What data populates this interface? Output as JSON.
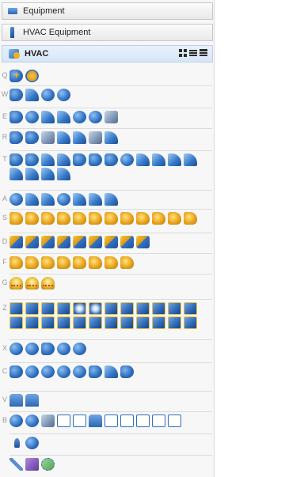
{
  "headers": {
    "equipment": "Equipment",
    "hvac_equipment": "HVAC Equipment",
    "hvac": "HVAC"
  },
  "view_tools": [
    "large-icons-view",
    "list-view",
    "details-view"
  ],
  "rows": [
    {
      "key": "Q",
      "icons": [
        "duct-plus",
        "gear"
      ]
    },
    {
      "key": "W",
      "icons": [
        "duct",
        "elbow",
        "round",
        "flex"
      ]
    },
    {
      "key": "E",
      "icons": [
        "duct",
        "round",
        "elbow",
        "elbow",
        "round",
        "round",
        "grey"
      ]
    },
    {
      "key": "R",
      "icons": [
        "duct",
        "duct",
        "grey",
        "elbow",
        "elbow",
        "grey",
        "elbow"
      ]
    },
    {
      "key": "T",
      "icons": [
        "duct",
        "duct",
        "elbow",
        "elbow",
        "duct",
        "duct",
        "duct",
        "round",
        "elbow",
        "elbow",
        "elbow",
        "elbow",
        "elbow",
        "elbow",
        "elbow",
        "elbow"
      ]
    },
    {
      "key": "A",
      "icons": [
        "round",
        "elbow",
        "elbow",
        "round",
        "elbow",
        "elbow",
        "elbow"
      ]
    },
    {
      "key": "S",
      "icons": [
        "yel",
        "yel",
        "yel",
        "yel",
        "yel",
        "yel",
        "yel",
        "yel",
        "yel",
        "yel",
        "yel",
        "yel"
      ]
    },
    {
      "key": "D",
      "icons": [
        "yelb",
        "yelb",
        "yelb",
        "yelb",
        "yelb",
        "yelb",
        "yelb",
        "yelb",
        "yelb"
      ]
    },
    {
      "key": "F",
      "icons": [
        "yel",
        "yel",
        "yel",
        "yel",
        "yel",
        "yel",
        "yel",
        "yel"
      ]
    },
    {
      "key": "G",
      "icons": [
        "fan",
        "fan",
        "fan"
      ]
    },
    {
      "key": "Z",
      "icons": [
        "sqr",
        "sqr",
        "sqr",
        "sqr",
        "sqrw",
        "sqrw",
        "sqr",
        "sqr",
        "sqr",
        "sqr",
        "sqr",
        "sqr",
        "sqr",
        "sqr",
        "sqr",
        "sqr",
        "sqr",
        "sqr",
        "sqr",
        "sqr",
        "sqr",
        "sqr",
        "sqr",
        "sqr"
      ]
    },
    {
      "key": "X",
      "icons": [
        "round",
        "round",
        "duct",
        "round",
        "round"
      ]
    },
    {
      "key": "C",
      "icons": [
        "duct",
        "round",
        "round",
        "round",
        "round",
        "duct",
        "elbow",
        "duct"
      ]
    },
    {
      "key": "V",
      "icons": [
        "stand",
        "stand"
      ]
    },
    {
      "key": "B",
      "icons": [
        "round",
        "round",
        "grey",
        "outline",
        "outline",
        "stand",
        "outline",
        "outline",
        "outline",
        "outline",
        "outline"
      ]
    },
    {
      "key": "",
      "icons": [
        "flame",
        "round"
      ]
    },
    {
      "key": "",
      "icons": [
        "wrench",
        "box3d",
        "tag"
      ]
    }
  ]
}
